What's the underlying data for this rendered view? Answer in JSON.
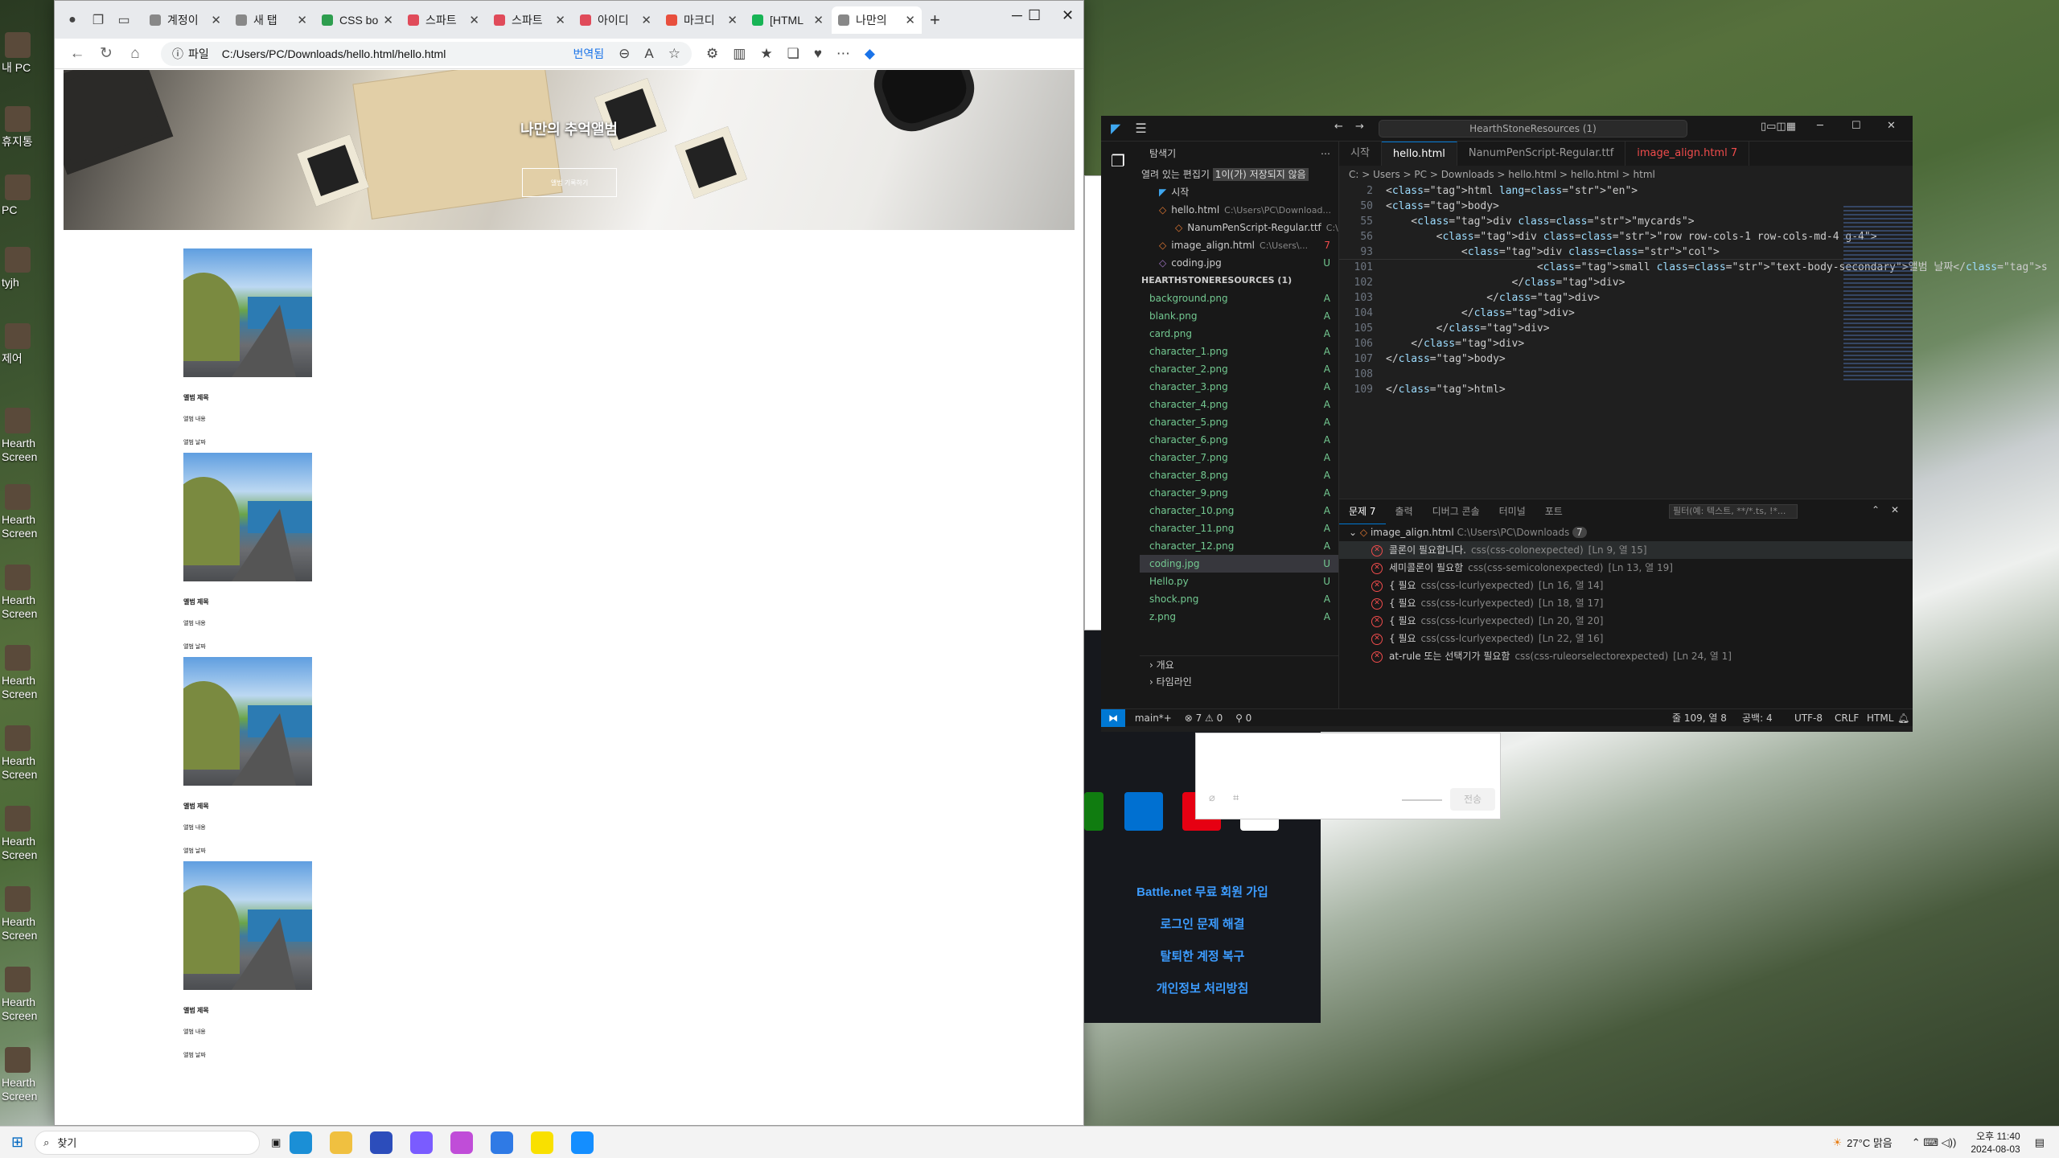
{
  "desktop": {
    "icons": [
      "내 PC",
      "휴지통",
      "PC",
      "tyjh",
      "제어",
      "Hearth Screen",
      "Hearth Screen",
      "Hearth Screen",
      "Hearth Screen",
      "Hearth Screen",
      "Hearth Screen",
      "Hearth Screen",
      "Hearth Screen",
      "Hearth Screen"
    ]
  },
  "browser": {
    "tabs": [
      {
        "label": "계정이",
        "color": "#888"
      },
      {
        "label": "새 탭",
        "color": "#888"
      },
      {
        "label": "CSS bo",
        "color": "#2e9e4f"
      },
      {
        "label": "스파트",
        "color": "#e04b5a"
      },
      {
        "label": "스파트",
        "color": "#e04b5a"
      },
      {
        "label": "아이디",
        "color": "#e04b5a"
      },
      {
        "label": "마크디",
        "color": "#e84f3d"
      },
      {
        "label": "[HTML",
        "color": "#17b455"
      },
      {
        "label": "나만의",
        "color": "#888"
      }
    ],
    "file_label": "파일",
    "url": "C:/Users/PC/Downloads/hello.html/hello.html",
    "translate": "번역됨",
    "page": {
      "hero_title": "나만의 추억앨범",
      "hero_button": "앨범 기록하기",
      "cards": [
        {
          "title": "앨범 제목",
          "text": "앨범 내용",
          "date": "앨범 날짜"
        },
        {
          "title": "앨범 제목",
          "text": "앨범 내용",
          "date": "앨범 날짜"
        },
        {
          "title": "앨범 제목",
          "text": "앨범 내용",
          "date": "앨범 날짜"
        },
        {
          "title": "앨범 제목",
          "text": "앨범 내용",
          "date": "앨범 날짜"
        }
      ]
    }
  },
  "battlenet": {
    "links": [
      "Battle.net 무료 회원 가입",
      "로그인 문제 해결",
      "탈퇴한 계정 복구",
      "개인정보 처리방침"
    ],
    "send": "전송"
  },
  "vscode": {
    "search": "HearthStoneResources (1)",
    "explorer_title": "탐색기",
    "open_editors": "열려 있는 편집기",
    "unsaved": "1이(가) 저장되지 않음",
    "open_files": [
      {
        "name": "시작",
        "path": "",
        "st": ""
      },
      {
        "name": "hello.html",
        "path": "C:\\Users\\PC\\Download...",
        "st": ""
      },
      {
        "name": "NanumPenScript-Regular.ttf",
        "path": "C:\\...",
        "st": ""
      },
      {
        "name": "image_align.html",
        "path": "C:\\Users\\...",
        "st": "7"
      },
      {
        "name": "coding.jpg",
        "path": "",
        "st": "U"
      }
    ],
    "folder": "HEARTHSTONERESOURCES (1)",
    "files": [
      {
        "name": "background.png",
        "st": "A"
      },
      {
        "name": "blank.png",
        "st": "A"
      },
      {
        "name": "card.png",
        "st": "A"
      },
      {
        "name": "character_1.png",
        "st": "A"
      },
      {
        "name": "character_2.png",
        "st": "A"
      },
      {
        "name": "character_3.png",
        "st": "A"
      },
      {
        "name": "character_4.png",
        "st": "A"
      },
      {
        "name": "character_5.png",
        "st": "A"
      },
      {
        "name": "character_6.png",
        "st": "A"
      },
      {
        "name": "character_7.png",
        "st": "A"
      },
      {
        "name": "character_8.png",
        "st": "A"
      },
      {
        "name": "character_9.png",
        "st": "A"
      },
      {
        "name": "character_10.png",
        "st": "A"
      },
      {
        "name": "character_11.png",
        "st": "A"
      },
      {
        "name": "character_12.png",
        "st": "A"
      },
      {
        "name": "coding.jpg",
        "st": "U"
      },
      {
        "name": "Hello.py",
        "st": "U"
      },
      {
        "name": "shock.png",
        "st": "A"
      },
      {
        "name": "z.png",
        "st": "A"
      }
    ],
    "outline": "개요",
    "timeline": "타임라인",
    "editor_tabs": [
      "시작",
      "hello.html",
      "NanumPenScript-Regular.ttf",
      "image_align.html 7"
    ],
    "breadcrumb": "C: > Users > PC > Downloads > hello.html > hello.html > html",
    "code": [
      {
        "n": "2",
        "t": "<html lang=\"en\">"
      },
      {
        "n": "50",
        "t": "<body>"
      },
      {
        "n": "55",
        "t": "    <div class=\"mycards\">"
      },
      {
        "n": "56",
        "t": "        <div class=\"row row-cols-1 row-cols-md-4 g-4\">"
      },
      {
        "n": "93",
        "t": "            <div class=\"col\">"
      },
      {
        "n": "101",
        "t": "                        <small class=\"text-body-secondary\">앨범 날짜</s"
      },
      {
        "n": "102",
        "t": "                    </div>"
      },
      {
        "n": "103",
        "t": "                </div>"
      },
      {
        "n": "104",
        "t": "            </div>"
      },
      {
        "n": "105",
        "t": "        </div>"
      },
      {
        "n": "106",
        "t": "    </div>"
      },
      {
        "n": "107",
        "t": "</body>"
      },
      {
        "n": "108",
        "t": ""
      },
      {
        "n": "109",
        "t": "</html>"
      }
    ],
    "panel_tabs": [
      "문제 7",
      "출력",
      "디버그 콘솔",
      "터미널",
      "포트"
    ],
    "filter": "필터(예: 텍스트, **/*.ts, !*...",
    "problem_file": "image_align.html",
    "problem_path": "C:\\Users\\PC\\Downloads",
    "problem_count": "7",
    "problems": [
      {
        "msg": "콜론이 필요합니다.",
        "src": "css(css-colonexpected)",
        "loc": "[Ln 9, 열 15]"
      },
      {
        "msg": "세미콜론이 필요함",
        "src": "css(css-semicolonexpected)",
        "loc": "[Ln 13, 열 19]"
      },
      {
        "msg": "{ 필요",
        "src": "css(css-lcurlyexpected)",
        "loc": "[Ln 16, 열 14]"
      },
      {
        "msg": "{ 필요",
        "src": "css(css-lcurlyexpected)",
        "loc": "[Ln 18, 열 17]"
      },
      {
        "msg": "{ 필요",
        "src": "css(css-lcurlyexpected)",
        "loc": "[Ln 20, 열 20]"
      },
      {
        "msg": "{ 필요",
        "src": "css(css-lcurlyexpected)",
        "loc": "[Ln 22, 열 16]"
      },
      {
        "msg": "at-rule 또는 선택기가 필요함",
        "src": "css(css-ruleorselectorexpected)",
        "loc": "[Ln 24, 열 1]"
      }
    ],
    "status": {
      "branch": "main*+",
      "errors": "⊗ 7 ⚠ 0",
      "ports": "0",
      "pos": "줄 109, 열 8",
      "spaces": "공백: 4",
      "enc": "UTF-8",
      "eol": "CRLF",
      "lang": "HTML"
    }
  },
  "taskbar": {
    "search": "찾기",
    "weather": "27°C 맑음",
    "time": "오후 11:40",
    "date": "2024-08-03"
  }
}
